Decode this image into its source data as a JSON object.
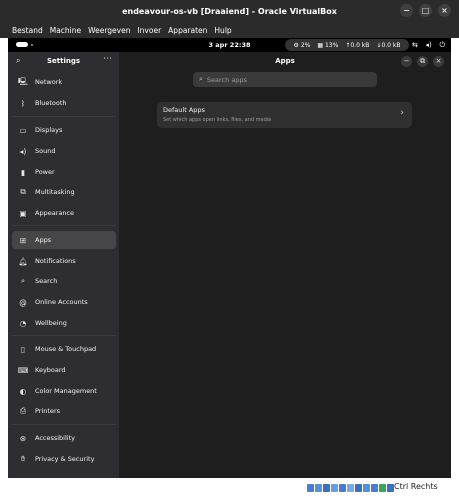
{
  "window": {
    "title": "endeavour-os-vb [Draaiend] - Oracle VirtualBox",
    "controls": [
      "−",
      "□",
      "×"
    ]
  },
  "menubar": [
    "Bestand",
    "Machine",
    "Weergeven",
    "Invoer",
    "Apparaten",
    "Hulp"
  ],
  "topbar": {
    "clock": "3 apr  22:38",
    "cpu": "2%",
    "mem": "13%",
    "upload": "0.0 kB",
    "download": "0.0 kB"
  },
  "sidebar": {
    "title": "Settings",
    "groups": [
      [
        {
          "label": "Network",
          "icon": "network-icon"
        },
        {
          "label": "Bluetooth",
          "icon": "bluetooth-icon"
        }
      ],
      [
        {
          "label": "Displays",
          "icon": "display-icon"
        },
        {
          "label": "Sound",
          "icon": "sound-icon"
        },
        {
          "label": "Power",
          "icon": "power-icon"
        },
        {
          "label": "Multitasking",
          "icon": "multitasking-icon"
        },
        {
          "label": "Appearance",
          "icon": "appearance-icon"
        }
      ],
      [
        {
          "label": "Apps",
          "icon": "apps-icon",
          "active": true
        },
        {
          "label": "Notifications",
          "icon": "bell-icon"
        },
        {
          "label": "Search",
          "icon": "search-icon"
        },
        {
          "label": "Online Accounts",
          "icon": "at-icon"
        },
        {
          "label": "Wellbeing",
          "icon": "wellbeing-icon"
        }
      ],
      [
        {
          "label": "Mouse & Touchpad",
          "icon": "mouse-icon"
        },
        {
          "label": "Keyboard",
          "icon": "keyboard-icon"
        },
        {
          "label": "Color Management",
          "icon": "color-icon"
        },
        {
          "label": "Printers",
          "icon": "printer-icon"
        }
      ],
      [
        {
          "label": "Accessibility",
          "icon": "accessibility-icon"
        },
        {
          "label": "Privacy & Security",
          "icon": "privacy-icon"
        }
      ]
    ]
  },
  "main": {
    "title": "Apps",
    "search_placeholder": "Search apps",
    "default_apps": {
      "title": "Default Apps",
      "subtitle": "Set which apps open links, files, and media"
    }
  },
  "statusbar": {
    "host_key": "Ctrl Rechts"
  },
  "colors": {
    "sidebar_bg": "#2e2e32",
    "content_bg": "#1e1e1e",
    "active_item": "#464649",
    "card_bg": "#303030"
  }
}
